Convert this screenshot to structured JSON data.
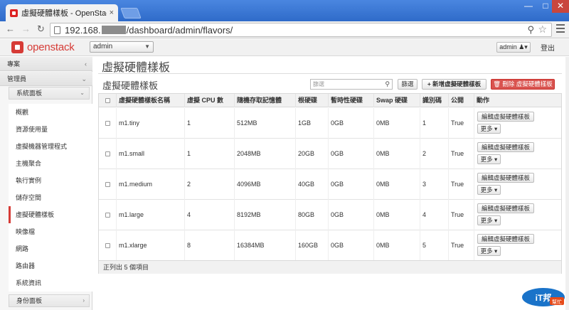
{
  "browser": {
    "tab_title": "虛擬硬體樣板 - OpenStack",
    "tab_close": "×",
    "url_prefix": "192.168.",
    "url_suffix": "/dashboard/admin/flavors/",
    "window_min": "—",
    "window_max": "□",
    "window_close": "✕"
  },
  "header": {
    "logo_text": "openstack",
    "project_select": "admin",
    "user_label": "admin",
    "signout": "登出"
  },
  "sidebar": {
    "project": "專案",
    "admin": "管理員",
    "system_panel": "系統面板",
    "items": [
      {
        "label": "概觀",
        "active": false
      },
      {
        "label": "資源使用量",
        "active": false
      },
      {
        "label": "虛擬機器管理程式",
        "active": false
      },
      {
        "label": "主機聚合",
        "active": false
      },
      {
        "label": "執行實例",
        "active": false
      },
      {
        "label": "儲存空間",
        "active": false
      },
      {
        "label": "虛擬硬體樣板",
        "active": true
      },
      {
        "label": "映像檔",
        "active": false
      },
      {
        "label": "網路",
        "active": false
      },
      {
        "label": "路由器",
        "active": false
      },
      {
        "label": "系統資訊",
        "active": false
      }
    ],
    "identity_panel": "身份面板"
  },
  "main": {
    "page_title": "虛擬硬體樣板",
    "table_title": "虛擬硬體樣板",
    "filter_placeholder": "篩選",
    "filter_button": "篩選",
    "create_button": "+ 新增虛擬硬體樣板",
    "delete_button": "刪除 虛擬硬體樣板",
    "columns": [
      "虛擬硬體樣板名稱",
      "虛擬 CPU 數",
      "隨機存取記憶體",
      "根硬碟",
      "暫時性硬碟",
      "Swap 硬碟",
      "識別碼",
      "公開",
      "動作"
    ],
    "rows": [
      {
        "name": "m1.tiny",
        "vcpus": "1",
        "ram": "512MB",
        "root": "1GB",
        "ephemeral": "0GB",
        "swap": "0MB",
        "id": "1",
        "public": "True"
      },
      {
        "name": "m1.small",
        "vcpus": "1",
        "ram": "2048MB",
        "root": "20GB",
        "ephemeral": "0GB",
        "swap": "0MB",
        "id": "2",
        "public": "True"
      },
      {
        "name": "m1.medium",
        "vcpus": "2",
        "ram": "4096MB",
        "root": "40GB",
        "ephemeral": "0GB",
        "swap": "0MB",
        "id": "3",
        "public": "True"
      },
      {
        "name": "m1.large",
        "vcpus": "4",
        "ram": "8192MB",
        "root": "80GB",
        "ephemeral": "0GB",
        "swap": "0MB",
        "id": "4",
        "public": "True"
      },
      {
        "name": "m1.xlarge",
        "vcpus": "8",
        "ram": "16384MB",
        "root": "160GB",
        "ephemeral": "0GB",
        "swap": "0MB",
        "id": "5",
        "public": "True"
      }
    ],
    "edit_button": "編輯虛擬硬體樣板",
    "more_button": "更多",
    "footer": "正列出 5 個項目"
  },
  "watermark": {
    "text": "iT邦幫忙"
  },
  "colors": {
    "brand": "#d63b36",
    "delete": "#d9534f"
  }
}
